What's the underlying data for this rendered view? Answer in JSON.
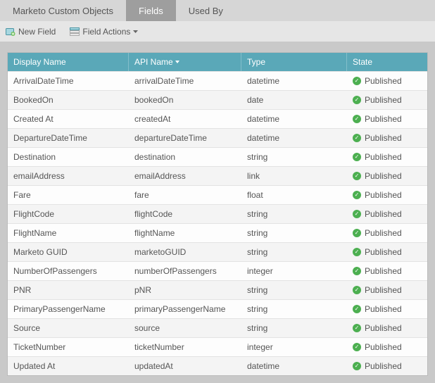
{
  "tabs": {
    "items": [
      {
        "label": "Marketo Custom Objects",
        "active": false
      },
      {
        "label": "Fields",
        "active": true
      },
      {
        "label": "Used By",
        "active": false
      }
    ]
  },
  "toolbar": {
    "new_field_label": "New Field",
    "field_actions_label": "Field Actions"
  },
  "table": {
    "headers": {
      "display_name": "Display Name",
      "api_name": "API Name",
      "type": "Type",
      "state": "State"
    },
    "sort_column": "api_name",
    "rows": [
      {
        "display_name": "ArrivalDateTime",
        "api_name": "arrivalDateTime",
        "type": "datetime",
        "state": "Published"
      },
      {
        "display_name": "BookedOn",
        "api_name": "bookedOn",
        "type": "date",
        "state": "Published"
      },
      {
        "display_name": "Created At",
        "api_name": "createdAt",
        "type": "datetime",
        "state": "Published"
      },
      {
        "display_name": "DepartureDateTime",
        "api_name": "departureDateTime",
        "type": "datetime",
        "state": "Published"
      },
      {
        "display_name": "Destination",
        "api_name": "destination",
        "type": "string",
        "state": "Published"
      },
      {
        "display_name": "emailAddress",
        "api_name": "emailAddress",
        "type": "link",
        "state": "Published"
      },
      {
        "display_name": "Fare",
        "api_name": "fare",
        "type": "float",
        "state": "Published"
      },
      {
        "display_name": "FlightCode",
        "api_name": "flightCode",
        "type": "string",
        "state": "Published"
      },
      {
        "display_name": "FlightName",
        "api_name": "flightName",
        "type": "string",
        "state": "Published"
      },
      {
        "display_name": "Marketo GUID",
        "api_name": "marketoGUID",
        "type": "string",
        "state": "Published"
      },
      {
        "display_name": "NumberOfPassengers",
        "api_name": "numberOfPassengers",
        "type": "integer",
        "state": "Published"
      },
      {
        "display_name": "PNR",
        "api_name": "pNR",
        "type": "string",
        "state": "Published"
      },
      {
        "display_name": "PrimaryPassengerName",
        "api_name": "primaryPassengerName",
        "type": "string",
        "state": "Published"
      },
      {
        "display_name": "Source",
        "api_name": "source",
        "type": "string",
        "state": "Published"
      },
      {
        "display_name": "TicketNumber",
        "api_name": "ticketNumber",
        "type": "integer",
        "state": "Published"
      },
      {
        "display_name": "Updated At",
        "api_name": "updatedAt",
        "type": "datetime",
        "state": "Published"
      }
    ]
  },
  "colors": {
    "header_bg": "#5aa8b8",
    "tab_active": "#9e9e9e",
    "state_ok": "#4caf50"
  }
}
